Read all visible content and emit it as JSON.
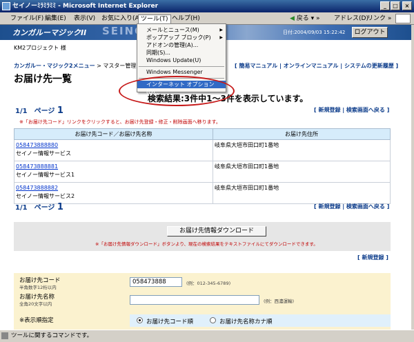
{
  "window": {
    "title": "セイノーﾐﾗﾐﾗﾐﾐ - Microsoft Internet Explorer"
  },
  "menubar": {
    "items": [
      "ファイル(F)",
      "編集(E)",
      "表示(V)",
      "お気に入り(A)",
      "ツール(T)",
      "ヘルプ(H)"
    ],
    "back_label": "戻る",
    "address_label": "アドレス(D)",
    "links_label": "リンク"
  },
  "tools_menu": {
    "items": [
      "メールとニュース(M)",
      "ポップアップ ブロック(P)",
      "アドオンの管理(A)...",
      "同期(S)...",
      "Windows Update(U)",
      "Windows Messenger",
      "インターネット オプション(O)..."
    ]
  },
  "header": {
    "logo": "カンガルーマジックII",
    "brand": "SEINO",
    "datetime": "日付:2004/09/03 15:22:42",
    "logout_label": "ログアウト",
    "company": "KM2プロジェクト 様"
  },
  "breadcrumb": {
    "menu": "カンガルー・マジック2メニュー",
    "sep": ">",
    "current": "マスター管理"
  },
  "top_links": "[ 簡易マニュアル | オンラインマニュアル | システムの更新履歴 ]",
  "page_title": "お届け先一覧",
  "search_result": "検索結果:3件中1～3件を表示しています。",
  "pager": {
    "prefix": "1/1",
    "suffix": "ページ",
    "current": "1"
  },
  "links": {
    "new_search": "[ 新規登録 | 検索画面へ戻る ]",
    "new": "[ 新規登録 ]"
  },
  "note": "※「お届け先コード」リンクをクリックすると、お届け先登録・修正・削除画面へ移ります。",
  "table": {
    "headers": [
      "お届け先コード／お届け先名称",
      "お届け先住所"
    ],
    "rows": [
      {
        "code": "058473888880",
        "name": "セイノー情報サービス",
        "address": "岐阜県大垣市田口町1番地"
      },
      {
        "code": "058473888881",
        "name": "セイノー情報サービス1",
        "address": "岐阜県大垣市田口町1番地"
      },
      {
        "code": "058473888882",
        "name": "セイノー情報サービス2",
        "address": "岐阜県大垣市田口町1番地"
      }
    ]
  },
  "download": {
    "button": "お届け先情報ダウンロード",
    "note": "※「お届け先情報ダウンロード」ボタンより、現在の検索結果をテキストファイルにてダウンロードできます。"
  },
  "form": {
    "code_label": "お届け先コード",
    "code_sub": "半角数字12桁以内",
    "code_value": "058473888",
    "code_example": "(例：012-345-6789)",
    "name_label": "お届け先名称",
    "name_sub": "全角20文字以内",
    "name_value": "",
    "name_example": "(例：西濃運輸)",
    "sort_label": "※表示順指定",
    "sort_options": [
      "お届け先コード順",
      "お届け先名称カナ順"
    ]
  },
  "status": "ツールに関するコマンドです。",
  "colors": {
    "title_bar": "#0a246a",
    "header": "#1d4f8e",
    "link": "#0b3b8a",
    "alert": "#c00000",
    "highlight": "#316ac5"
  }
}
